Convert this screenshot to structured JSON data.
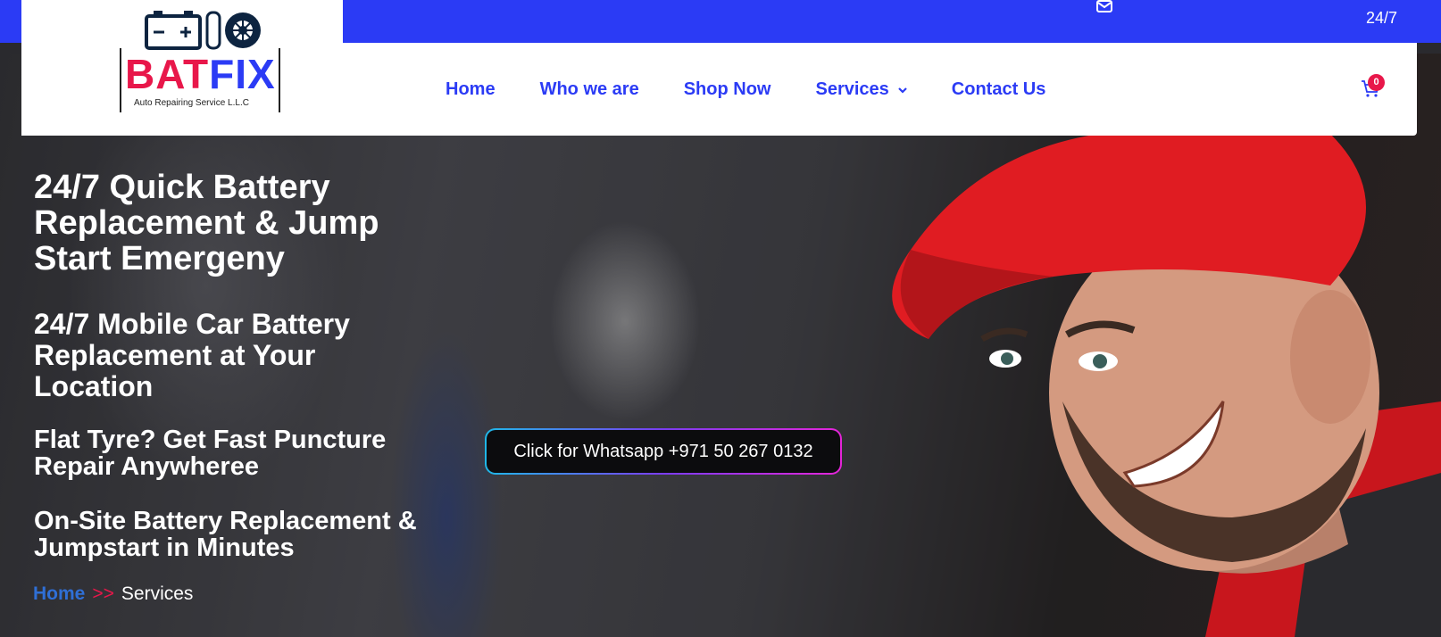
{
  "topbar": {
    "hours": "24/7",
    "mail_icon": "envelope-icon",
    "background": "#2b3bf5"
  },
  "logo": {
    "brand_part1": "BAT",
    "brand_part2": "FIX",
    "tagline": "Auto Repairing Service L.L.C",
    "icon": "battery-and-tyre-icon"
  },
  "nav": {
    "items": [
      {
        "label": "Home"
      },
      {
        "label": "Who we are"
      },
      {
        "label": "Shop Now"
      },
      {
        "label": "Services",
        "has_dropdown": true
      },
      {
        "label": "Contact Us"
      }
    ],
    "dropdown_icon": "chevron-down-icon"
  },
  "cart": {
    "icon": "cart-icon",
    "count": "0"
  },
  "hero": {
    "heading1": "24/7 Quick Battery Replacement & Jump Start Emergeny",
    "heading2": "24/7 Mobile Car Battery Replacement at Your Location",
    "heading3": "Flat Tyre? Get Fast Puncture Repair Anywheree",
    "heading4": "On-Site Battery Replacement & Jumpstart in Minutes",
    "whatsapp_button": "Click for Whatsapp +971 50 267 0132"
  },
  "breadcrumb": {
    "home": "Home",
    "separator": ">>",
    "current": "Services"
  },
  "colors": {
    "brand_blue": "#2b3bf5",
    "brand_red": "#e8174a"
  }
}
